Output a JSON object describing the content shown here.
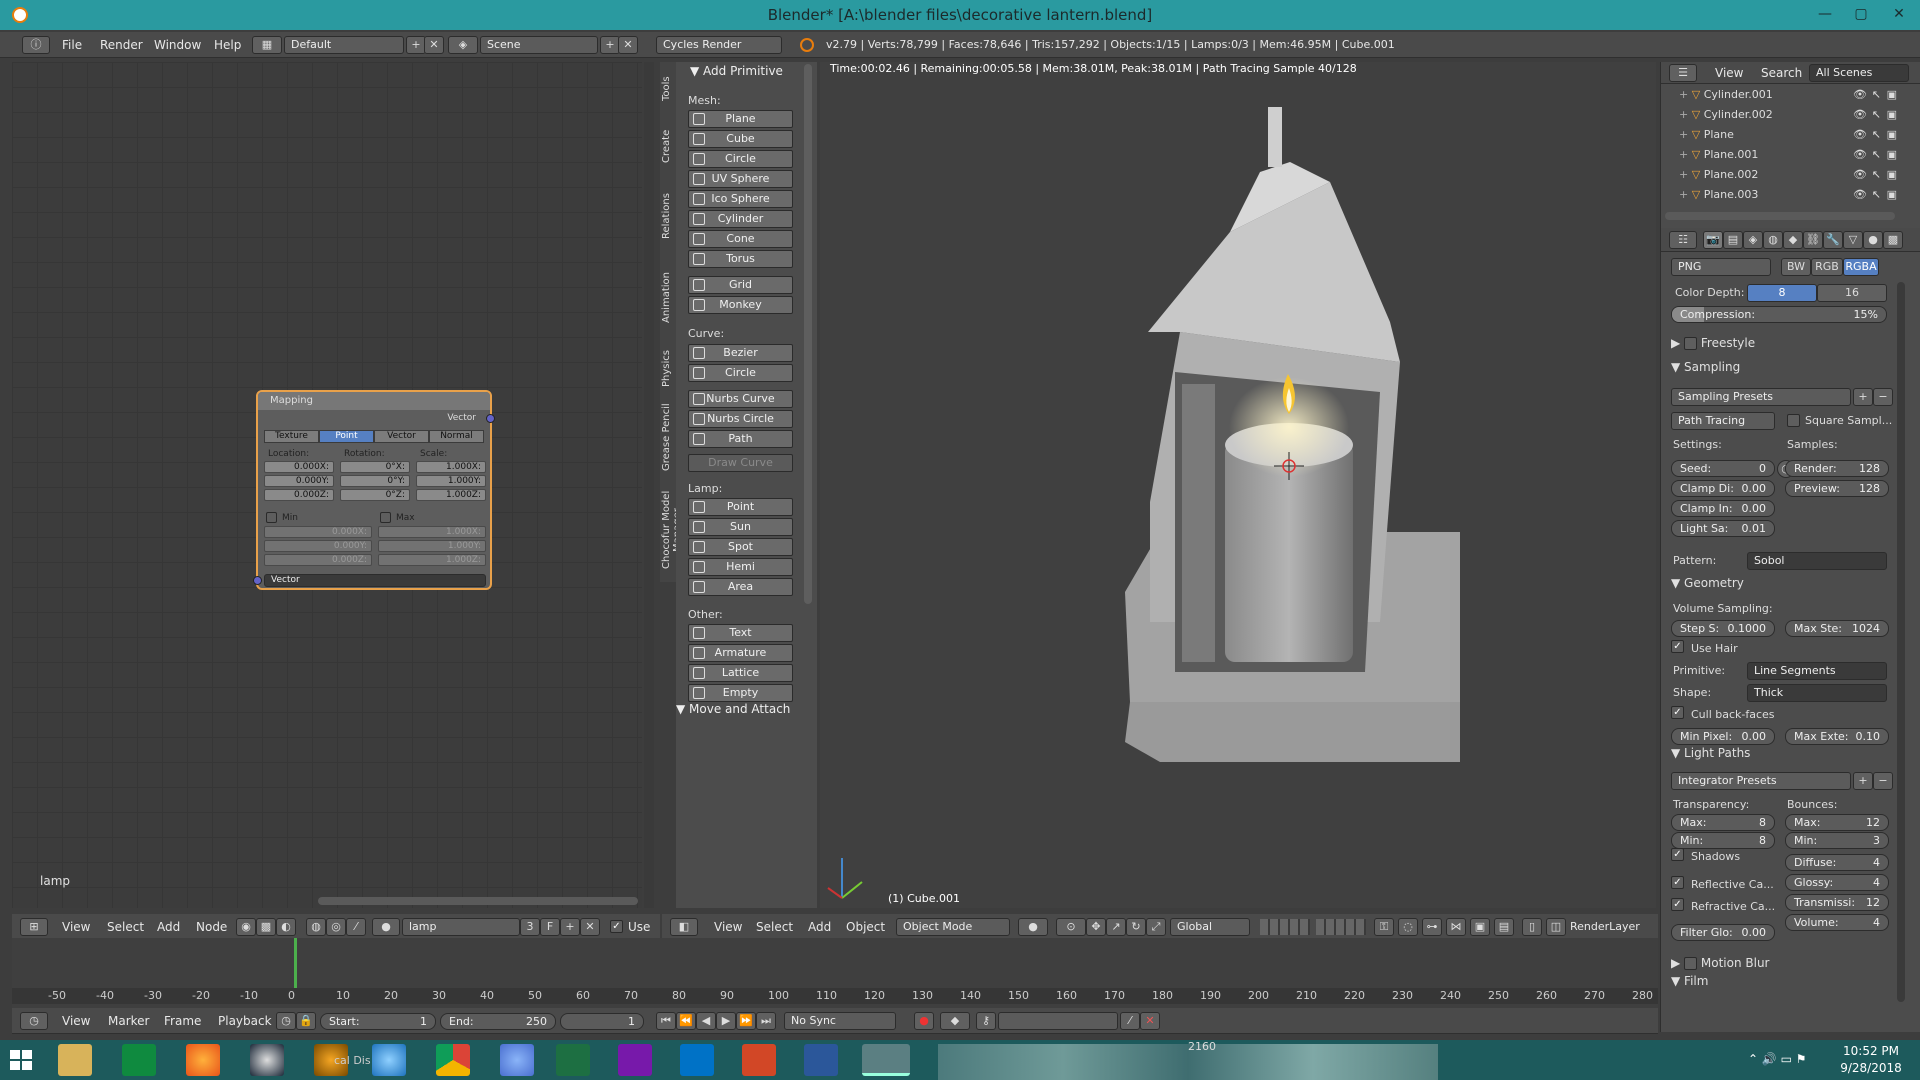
{
  "window": {
    "title": "Blender* [A:\\blender files\\decorative lantern.blend]",
    "min": "—",
    "max": "▢",
    "close": "✕"
  },
  "topbar": {
    "menus": [
      "File",
      "Render",
      "Window",
      "Help"
    ],
    "layout": "Default",
    "scene": "Scene",
    "engine": "Cycles Render",
    "stats": "v2.79 | Verts:78,799 | Faces:78,646 | Tris:157,292 | Objects:1/15 | Lamps:0/3 | Mem:46.95M | Cube.001"
  },
  "node_editor": {
    "node": {
      "title": "Mapping",
      "output": "Vector",
      "tabs": [
        "Texture",
        "Point",
        "Vector",
        "Normal"
      ],
      "active_tab": "Point",
      "location_label": "Location:",
      "rotation_label": "Rotation:",
      "scale_label": "Scale:",
      "location": [
        {
          "k": "X:",
          "v": "0.000"
        },
        {
          "k": "Y:",
          "v": "0.000"
        },
        {
          "k": "Z:",
          "v": "0.000"
        }
      ],
      "rotation": [
        {
          "k": "X:",
          "v": "0°"
        },
        {
          "k": "Y:",
          "v": "0°"
        },
        {
          "k": "Z:",
          "v": "0°"
        }
      ],
      "scale": [
        {
          "k": "X:",
          "v": "1.000"
        },
        {
          "k": "Y:",
          "v": "1.000"
        },
        {
          "k": "Z:",
          "v": "1.000"
        }
      ],
      "min_label": "Min",
      "max_label": "Max",
      "min": [
        {
          "k": "X:",
          "v": "0.000"
        },
        {
          "k": "Y:",
          "v": "0.000"
        },
        {
          "k": "Z:",
          "v": "0.000"
        }
      ],
      "max": [
        {
          "k": "X:",
          "v": "1.000"
        },
        {
          "k": "Y:",
          "v": "1.000"
        },
        {
          "k": "Z:",
          "v": "1.000"
        }
      ],
      "input": "Vector"
    },
    "material_label": "lamp",
    "header": {
      "menus": [
        "View",
        "Select",
        "Add",
        "Node"
      ],
      "material": "lamp",
      "users": "3",
      "fake": "F",
      "use": "Use"
    }
  },
  "tools": {
    "tabs": [
      "Tools",
      "Create",
      "Relations",
      "Animation",
      "Physics",
      "Grease Pencil",
      "Chocofur Model Manager"
    ],
    "panel_title": "Add Primitive",
    "mesh_label": "Mesh:",
    "mesh": [
      "Plane",
      "Cube",
      "Circle",
      "UV Sphere",
      "Ico Sphere",
      "Cylinder",
      "Cone",
      "Torus"
    ],
    "mesh2": [
      "Grid",
      "Monkey"
    ],
    "curve_label": "Curve:",
    "curve": [
      "Bezier",
      "Circle"
    ],
    "curve2": [
      "Nurbs Curve",
      "Nurbs Circle",
      "Path"
    ],
    "draw_curve": "Draw Curve",
    "lamp_label": "Lamp:",
    "lamp": [
      "Point",
      "Sun",
      "Spot",
      "Hemi",
      "Area"
    ],
    "other_label": "Other:",
    "other": [
      "Text",
      "Armature",
      "Lattice",
      "Empty"
    ],
    "move_attach": "Move and Attach"
  },
  "viewport": {
    "render_info": "Time:00:02.46 | Remaining:00:05.58 | Mem:38.01M, Peak:38.01M | Path Tracing Sample 40/128",
    "object_label": "(1) Cube.001",
    "header": {
      "menus": [
        "View",
        "Select",
        "Add",
        "Object"
      ],
      "mode": "Object Mode",
      "orientation": "Global",
      "layer": "RenderLayer"
    }
  },
  "outliner": {
    "menus": [
      "View",
      "Search"
    ],
    "filter": "All Scenes",
    "items": [
      "Cylinder.001",
      "Cylinder.002",
      "Plane",
      "Plane.001",
      "Plane.002",
      "Plane.003"
    ]
  },
  "properties": {
    "format": "PNG",
    "color_modes": [
      "BW",
      "RGB",
      "RGBA"
    ],
    "active_color_mode": "RGBA",
    "color_depth_label": "Color Depth:",
    "depths": [
      "8",
      "16"
    ],
    "compression_label": "Compression:",
    "compression": "15%",
    "compression_fraction": 0.15,
    "freestyle": "Freestyle",
    "sampling": {
      "title": "Sampling",
      "presets": "Sampling Presets",
      "integrator": "Path Tracing",
      "square": "Square Sampl...",
      "settings_label": "Settings:",
      "samples_label": "Samples:",
      "seed": {
        "k": "Seed:",
        "v": "0"
      },
      "clamp_direct": {
        "k": "Clamp Di:",
        "v": "0.00"
      },
      "clamp_indirect": {
        "k": "Clamp In:",
        "v": "0.00"
      },
      "light_sampling": {
        "k": "Light Sa:",
        "v": "0.01"
      },
      "render": {
        "k": "Render:",
        "v": "128"
      },
      "preview": {
        "k": "Preview:",
        "v": "128"
      },
      "pattern_label": "Pattern:",
      "pattern": "Sobol"
    },
    "geometry": {
      "title": "Geometry",
      "volume_label": "Volume Sampling:",
      "step": {
        "k": "Step S:",
        "v": "0.1000"
      },
      "max_steps": {
        "k": "Max Ste:",
        "v": "1024"
      },
      "use_hair": "Use Hair",
      "primitive_label": "Primitive:",
      "primitive": "Line Segments",
      "shape_label": "Shape:",
      "shape": "Thick",
      "cull": "Cull back-faces",
      "min_pixel": {
        "k": "Min Pixel:",
        "v": "0.00"
      },
      "max_ext": {
        "k": "Max Exte:",
        "v": "0.10"
      }
    },
    "light_paths": {
      "title": "Light Paths",
      "presets": "Integrator Presets",
      "transparency_label": "Transparency:",
      "bounces_label": "Bounces:",
      "t_max": {
        "k": "Max:",
        "v": "8"
      },
      "t_min": {
        "k": "Min:",
        "v": "8"
      },
      "b_max": {
        "k": "Max:",
        "v": "12"
      },
      "b_min": {
        "k": "Min:",
        "v": "3"
      },
      "shadows": "Shadows",
      "reflective": "Reflective Ca...",
      "refractive": "Refractive Ca...",
      "filter_glossy": {
        "k": "Filter Glo:",
        "v": "0.00"
      },
      "diffuse": {
        "k": "Diffuse:",
        "v": "4"
      },
      "glossy": {
        "k": "Glossy:",
        "v": "4"
      },
      "transmission": {
        "k": "Transmissi:",
        "v": "12"
      },
      "volume": {
        "k": "Volume:",
        "v": "4"
      }
    },
    "motion_blur": "Motion Blur",
    "film": "Film"
  },
  "timeline": {
    "ticks": [
      "-50",
      "-40",
      "-30",
      "-20",
      "-10",
      "0",
      "10",
      "20",
      "30",
      "40",
      "50",
      "60",
      "70",
      "80",
      "90",
      "100",
      "110",
      "120",
      "130",
      "140",
      "150",
      "160",
      "170",
      "180",
      "190",
      "200",
      "210",
      "220",
      "230",
      "240",
      "250",
      "260",
      "270",
      "280"
    ],
    "menus": [
      "View",
      "Marker",
      "Frame",
      "Playback"
    ],
    "start": {
      "k": "Start:",
      "v": "1"
    },
    "end": {
      "k": "End:",
      "v": "250"
    },
    "current": "1",
    "sync": "No Sync",
    "extra": "2160"
  },
  "taskbar": {
    "time": "10:52 PM",
    "date": "9/28/2018",
    "item_label": "cal Dis"
  }
}
